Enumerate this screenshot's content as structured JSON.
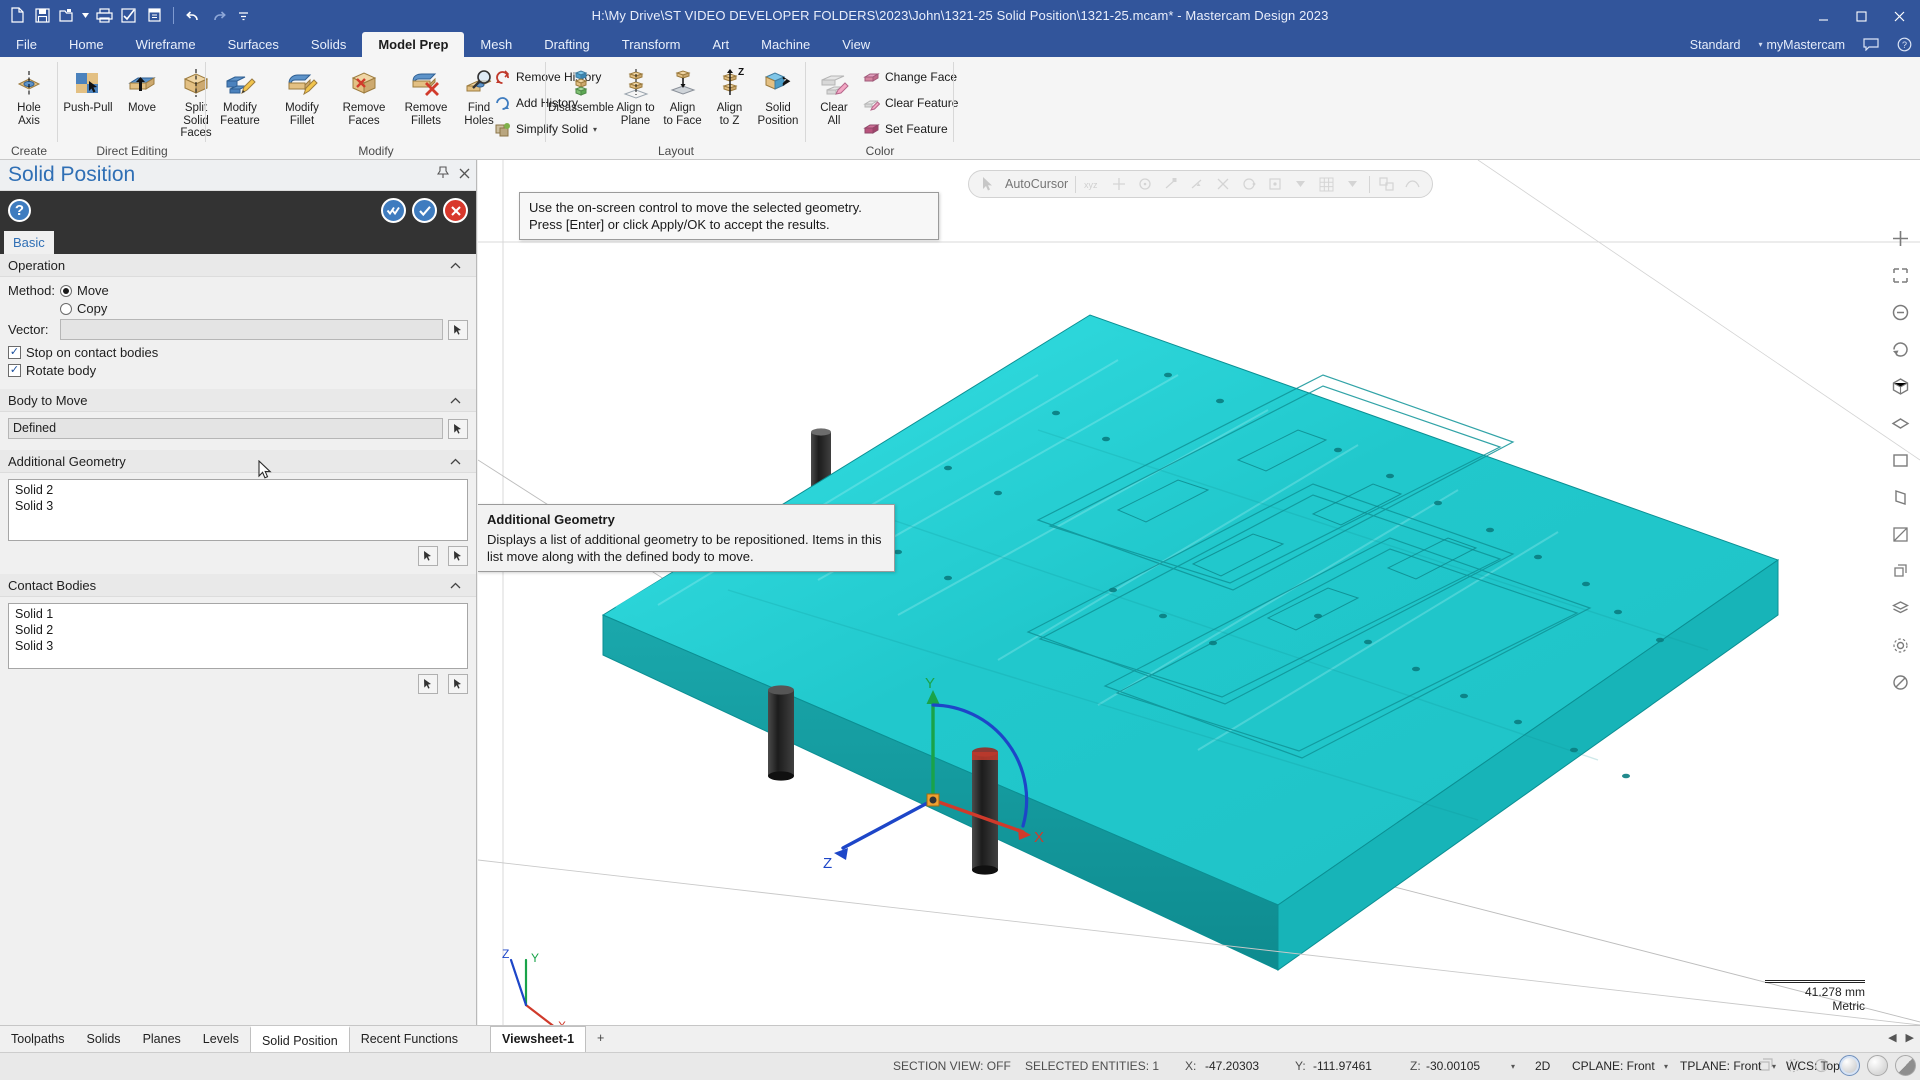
{
  "titlebar": {
    "document_title": "H:\\My Drive\\ST VIDEO DEVELOPER FOLDERS\\2023\\John\\1321-25 Solid Position\\1321-25.mcam* - Mastercam Design 2023",
    "quick_access": [
      {
        "name": "new-file-icon",
        "tooltip": "New"
      },
      {
        "name": "save-icon",
        "tooltip": "Save"
      },
      {
        "name": "open-folder-icon",
        "tooltip": "Open"
      },
      {
        "name": "print-icon",
        "tooltip": "Print"
      },
      {
        "name": "verify-icon",
        "tooltip": "Verify"
      },
      {
        "name": "backplot-icon",
        "tooltip": "Backplot"
      },
      {
        "name": "undo-icon",
        "tooltip": "Undo"
      },
      {
        "name": "redo-icon",
        "tooltip": "Redo"
      },
      {
        "name": "customize-qat-icon",
        "tooltip": "Customize Quick Access Toolbar"
      }
    ],
    "window_buttons": [
      "minimize",
      "maximize",
      "close"
    ]
  },
  "ribbon": {
    "tabs": [
      {
        "label": "File",
        "active": false
      },
      {
        "label": "Home",
        "active": false
      },
      {
        "label": "Wireframe",
        "active": false
      },
      {
        "label": "Surfaces",
        "active": false
      },
      {
        "label": "Solids",
        "active": false
      },
      {
        "label": "Model Prep",
        "active": true
      },
      {
        "label": "Mesh",
        "active": false
      },
      {
        "label": "Drafting",
        "active": false
      },
      {
        "label": "Transform",
        "active": false
      },
      {
        "label": "Art",
        "active": false
      },
      {
        "label": "Machine",
        "active": false
      },
      {
        "label": "View",
        "active": false
      }
    ],
    "right_items": [
      {
        "label": "Standard"
      },
      {
        "label": "myMastercam"
      }
    ],
    "groups": [
      {
        "name": "Create",
        "label": "Create",
        "buttons": [
          {
            "label": "Hole\nAxis",
            "icon": "hole-axis-icon"
          }
        ]
      },
      {
        "name": "Direct Editing",
        "label": "Direct Editing",
        "buttons": [
          {
            "label": "Push-Pull",
            "icon": "push-pull-icon"
          },
          {
            "label": "Move",
            "icon": "move-icon"
          },
          {
            "label": "Split Solid\nFaces",
            "icon": "split-solid-faces-icon"
          }
        ]
      },
      {
        "name": "Modify",
        "label": "Modify",
        "buttons": [
          {
            "label": "Modify\nFeature",
            "icon": "modify-feature-icon"
          },
          {
            "label": "Modify\nFillet",
            "icon": "modify-fillet-icon"
          },
          {
            "label": "Remove\nFaces",
            "icon": "remove-faces-icon"
          },
          {
            "label": "Remove\nFillets",
            "icon": "remove-fillets-icon"
          },
          {
            "label": "Find\nHoles",
            "icon": "find-holes-icon"
          }
        ],
        "small_buttons": [
          {
            "label": "Remove History",
            "icon": "remove-history-icon"
          },
          {
            "label": "Add History",
            "icon": "add-history-icon"
          },
          {
            "label": "Simplify Solid",
            "icon": "simplify-solid-icon",
            "has_dropdown": true
          }
        ]
      },
      {
        "name": "Layout",
        "label": "Layout",
        "buttons": [
          {
            "label": "Disassemble",
            "icon": "disassemble-icon"
          },
          {
            "label": "Align to\nPlane",
            "icon": "align-to-plane-icon"
          },
          {
            "label": "Align\nto Face",
            "icon": "align-to-face-icon"
          },
          {
            "label": "Align\nto Z",
            "icon": "align-to-z-icon"
          },
          {
            "label": "Solid\nPosition",
            "icon": "solid-position-icon"
          }
        ]
      },
      {
        "name": "Color",
        "label": "Color",
        "buttons": [
          {
            "label": "Clear\nAll",
            "icon": "clear-all-icon"
          }
        ],
        "small_buttons": [
          {
            "label": "Change Face",
            "icon": "change-face-icon"
          },
          {
            "label": "Clear Feature",
            "icon": "clear-feature-icon"
          },
          {
            "label": "Set Feature",
            "icon": "set-feature-icon"
          }
        ]
      }
    ]
  },
  "panel": {
    "title": "Solid Position",
    "pin_icon": "pin-icon",
    "close_icon": "close-icon",
    "help_label": "?",
    "toolbar_buttons": [
      {
        "name": "reapply-button",
        "glyph": "✓"
      },
      {
        "name": "ok-button",
        "glyph": "✓"
      },
      {
        "name": "cancel-button",
        "glyph": "✕"
      }
    ],
    "tab": "Basic",
    "sections": {
      "operation": {
        "title": "Operation",
        "method_label": "Method:",
        "method_options": [
          {
            "label": "Move",
            "selected": true
          },
          {
            "label": "Copy",
            "selected": false
          }
        ],
        "vector_label": "Vector:",
        "vector_value": "",
        "checkboxes": [
          {
            "label": "Stop on contact bodies",
            "checked": true
          },
          {
            "label": "Rotate body",
            "checked": true
          }
        ]
      },
      "body_to_move": {
        "title": "Body to Move",
        "value": "Defined"
      },
      "additional_geometry": {
        "title": "Additional Geometry",
        "items": [
          "Solid 2",
          "Solid 3"
        ]
      },
      "contact_bodies": {
        "title": "Contact Bodies",
        "items": [
          "Solid 1",
          "Solid 2",
          "Solid 3"
        ]
      }
    }
  },
  "graphics": {
    "autocursor": {
      "label": "AutoCursor",
      "icons": [
        "cursor-icon",
        "xyz-icon",
        "center-icon",
        "endpoint-icon",
        "midpoint-icon",
        "intersection-icon",
        "quadrant-icon",
        "point-icon",
        "grid-icon",
        "dropdown-icon",
        "relative-icon",
        "nearest-icon"
      ]
    },
    "hint_tooltip": {
      "line1": "Use the on-screen control to move the selected geometry.",
      "line2": "Press [Enter] or click Apply/OK to accept the results."
    },
    "help_tooltip": {
      "title": "Additional Geometry",
      "body": "Displays a list of additional geometry to be repositioned. Items in this list move along with the defined body to move."
    },
    "gnomon": {
      "x": "X",
      "y": "Y",
      "z": "Z"
    },
    "wcs_triad": {
      "x": "X",
      "y": "Y",
      "z": "Z"
    },
    "scale": {
      "value": "41.278 mm",
      "units": "Metric"
    }
  },
  "bottom_tabs": {
    "tabs": [
      {
        "label": "Toolpaths",
        "active": false
      },
      {
        "label": "Solids",
        "active": false
      },
      {
        "label": "Planes",
        "active": false
      },
      {
        "label": "Levels",
        "active": false
      },
      {
        "label": "Solid Position",
        "active": true
      },
      {
        "label": "Recent Functions",
        "active": false
      }
    ],
    "viewsheets": [
      {
        "label": "Viewsheet-1",
        "active": true
      },
      {
        "label": "+",
        "active": false
      }
    ]
  },
  "statusbar": {
    "section_view": "SECTION VIEW: OFF",
    "selected_entities": "SELECTED ENTITIES: 1",
    "coords": [
      {
        "label": "X:",
        "value": "-47.20303"
      },
      {
        "label": "Y:",
        "value": "-111.97461"
      },
      {
        "label": "Z:",
        "value": "-30.00105"
      }
    ],
    "dimension_mode": "2D",
    "cplane": "CPLANE: Front",
    "tplane": "TPLANE: Front",
    "wcs": "WCS: Top"
  },
  "colors": {
    "ribbon_blue": "#32559b",
    "panel_title_blue": "#2f6fb5",
    "solid_cyan": "#28d4d8",
    "cancel_red": "#d8382c",
    "accent_blue": "#3f7cbf"
  }
}
